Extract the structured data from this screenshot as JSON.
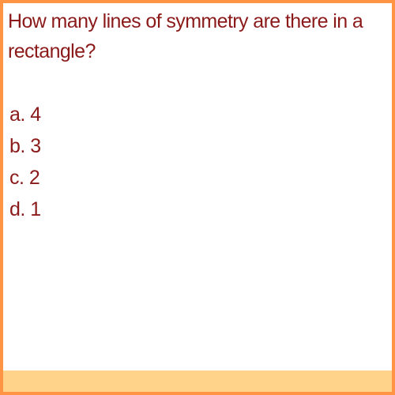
{
  "question": {
    "text": "How many lines of symmetry are there in a rectangle?"
  },
  "options": [
    {
      "label": "a. 4"
    },
    {
      "label": "b. 3"
    },
    {
      "label": "c. 2"
    },
    {
      "label": "d. 1"
    }
  ],
  "colors": {
    "border": "#ff9444",
    "text": "#8b1a1a",
    "footer": "#ffd38a",
    "background": "#ffffff"
  }
}
